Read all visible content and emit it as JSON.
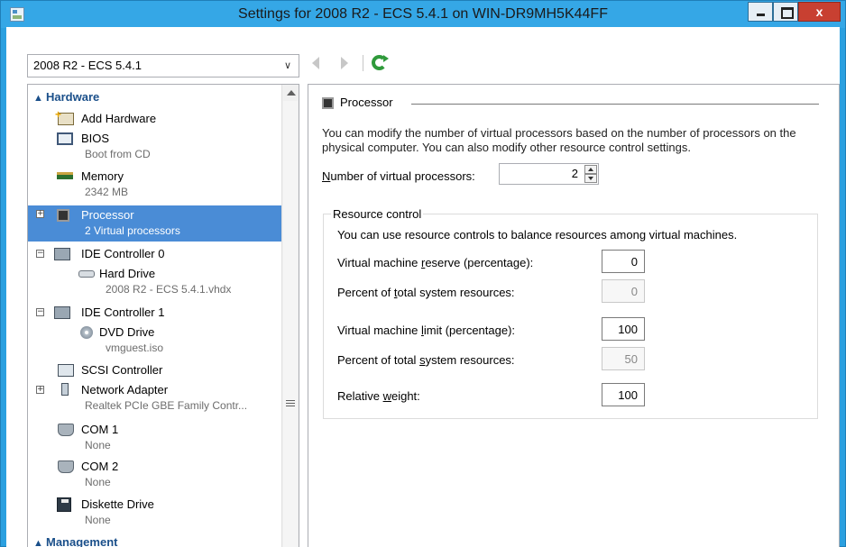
{
  "window": {
    "title": "Settings for 2008 R2 - ECS 5.4.1 on WIN-DR9MH5K44FF",
    "close_glyph": "x"
  },
  "toolbar": {
    "vm_selector_value": "2008 R2 - ECS 5.4.1"
  },
  "tree": {
    "hardware_header": "Hardware",
    "management_header": "Management",
    "items": [
      {
        "label": "Add Hardware",
        "sub": "",
        "icon": "add-hardware-icon"
      },
      {
        "label": "BIOS",
        "sub": "Boot from CD",
        "icon": "bios-icon"
      },
      {
        "label": "Memory",
        "sub": "2342 MB",
        "icon": "memory-icon"
      },
      {
        "label": "Processor",
        "sub": "2 Virtual processors",
        "icon": "processor-icon",
        "selected": true
      },
      {
        "label": "IDE Controller 0",
        "sub": "",
        "icon": "ide-controller-icon"
      },
      {
        "label": "Hard Drive",
        "sub": "2008 R2 - ECS 5.4.1.vhdx",
        "icon": "hard-drive-icon"
      },
      {
        "label": "IDE Controller 1",
        "sub": "",
        "icon": "ide-controller-icon"
      },
      {
        "label": "DVD Drive",
        "sub": "vmguest.iso",
        "icon": "dvd-drive-icon"
      },
      {
        "label": "SCSI Controller",
        "sub": "",
        "icon": "scsi-controller-icon"
      },
      {
        "label": "Network Adapter",
        "sub": "Realtek PCIe GBE Family Contr...",
        "icon": "network-adapter-icon"
      },
      {
        "label": "COM 1",
        "sub": "None",
        "icon": "com-port-icon"
      },
      {
        "label": "COM 2",
        "sub": "None",
        "icon": "com-port-icon"
      },
      {
        "label": "Diskette Drive",
        "sub": "None",
        "icon": "diskette-drive-icon"
      }
    ]
  },
  "processor": {
    "heading": "Processor",
    "description": "You can modify the number of virtual processors based on the number of processors on the physical computer. You can also modify other resource control settings.",
    "num_vp_label_pre": "",
    "num_vp_label_u": "N",
    "num_vp_label_post": "umber of virtual processors:",
    "num_vp_value": "2",
    "resource_control": {
      "title": "Resource control",
      "description": "You can use resource controls to balance resources among virtual machines.",
      "reserve_label_pre": "Virtual machine ",
      "reserve_label_u": "r",
      "reserve_label_post": "eserve (percentage):",
      "reserve_value": "0",
      "reserve_total_label_pre": "Percent of ",
      "reserve_total_label_u": "t",
      "reserve_total_label_post": "otal system resources:",
      "reserve_total_value": "0",
      "limit_label_pre": "Virtual machine ",
      "limit_label_u": "l",
      "limit_label_post": "imit (percentage):",
      "limit_value": "100",
      "limit_total_label_pre": "Percent of total ",
      "limit_total_label_u": "s",
      "limit_total_label_post": "ystem resources:",
      "limit_total_value": "50",
      "weight_label_pre": "Relative ",
      "weight_label_u": "w",
      "weight_label_post": "eight:",
      "weight_value": "100"
    }
  },
  "colors": {
    "titlebar": "#35a7e6",
    "selection": "#4a8cd6",
    "section_header": "#1a4f8a",
    "close_button": "#c84031"
  }
}
